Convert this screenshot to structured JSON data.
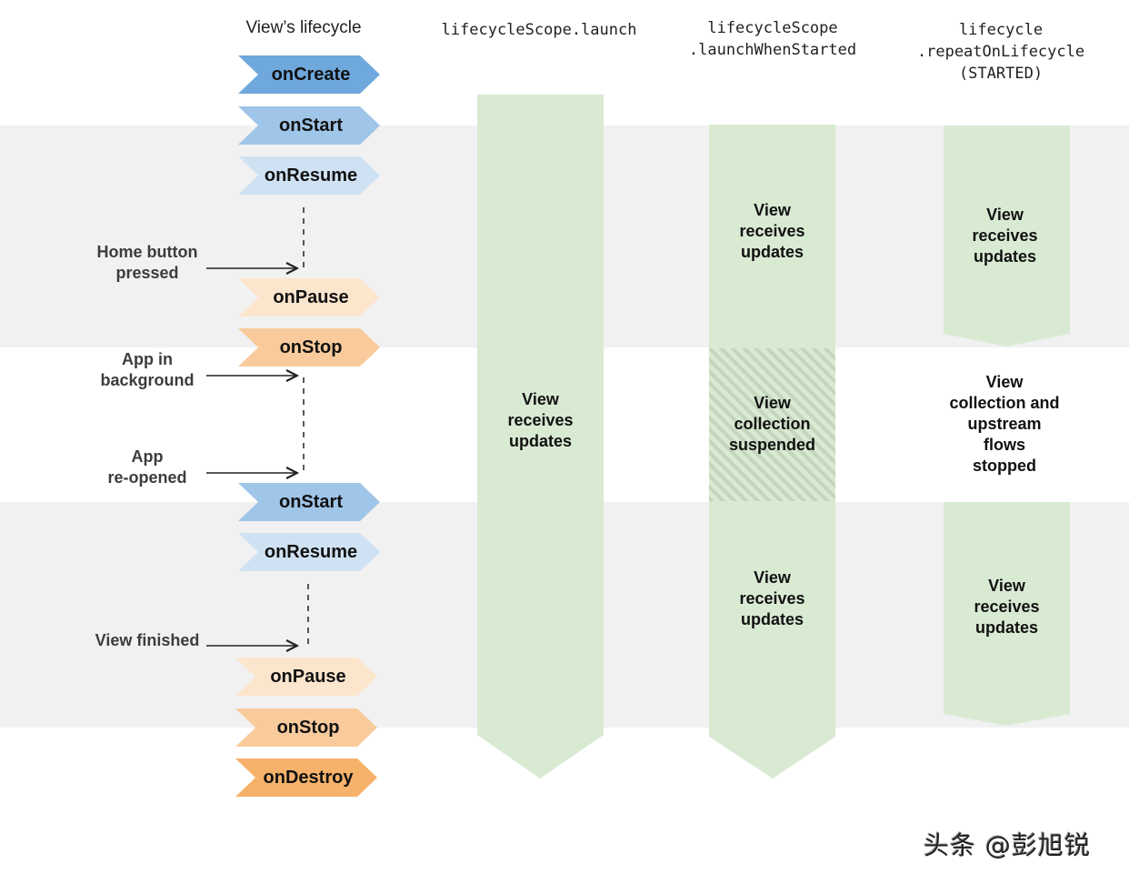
{
  "headers": {
    "lifecycle": "View’s lifecycle",
    "launch": "lifecycleScope.launch",
    "when_started_line1": "lifecycleScope",
    "when_started_line2": ".launchWhenStarted",
    "repeat_line1": "lifecycle",
    "repeat_line2": ".repeatOnLifecycle",
    "repeat_line3": "(STARTED)"
  },
  "lifecycle_steps": [
    {
      "label": "onCreate",
      "color": "#6fa8dc"
    },
    {
      "label": "onStart",
      "color": "#9fc5e8"
    },
    {
      "label": "onResume",
      "color": "#cfe2f3"
    },
    {
      "label": "onPause",
      "color": "#fce5cd"
    },
    {
      "label": "onStop",
      "color": "#f9cb9c"
    },
    {
      "label": "onStart",
      "color": "#9fc5e8"
    },
    {
      "label": "onResume",
      "color": "#cfe2f3"
    },
    {
      "label": "onPause",
      "color": "#fce5cd"
    },
    {
      "label": "onStop",
      "color": "#f9cb9c"
    },
    {
      "label": "onDestroy",
      "color": "#f6b26b"
    }
  ],
  "events": [
    {
      "line1": "Home button",
      "line2": "pressed"
    },
    {
      "line1": "App in",
      "line2": "background"
    },
    {
      "line1": "App",
      "line2": "re-opened"
    },
    {
      "line1": "View finished",
      "line2": ""
    }
  ],
  "columns": {
    "launch": {
      "text1": "View",
      "text2": "receives",
      "text3": "updates"
    },
    "when_started": {
      "active1": {
        "text1": "View",
        "text2": "receives",
        "text3": "updates"
      },
      "suspended": {
        "text1": "View",
        "text2": "collection",
        "text3": "suspended"
      },
      "active2": {
        "text1": "View",
        "text2": "receives",
        "text3": "updates"
      }
    },
    "repeat": {
      "active1": {
        "text1": "View",
        "text2": "receives",
        "text3": "updates"
      },
      "stopped": {
        "text1": "View",
        "text2": "collection and",
        "text3": "upstream",
        "text4": "flows",
        "text5": "stopped"
      },
      "active2": {
        "text1": "View",
        "text2": "receives",
        "text3": "updates"
      }
    }
  },
  "colors": {
    "active_fill": "#d9ead3",
    "band_gray": "#f1f1f1"
  },
  "watermark": "头条 @彭旭锐"
}
